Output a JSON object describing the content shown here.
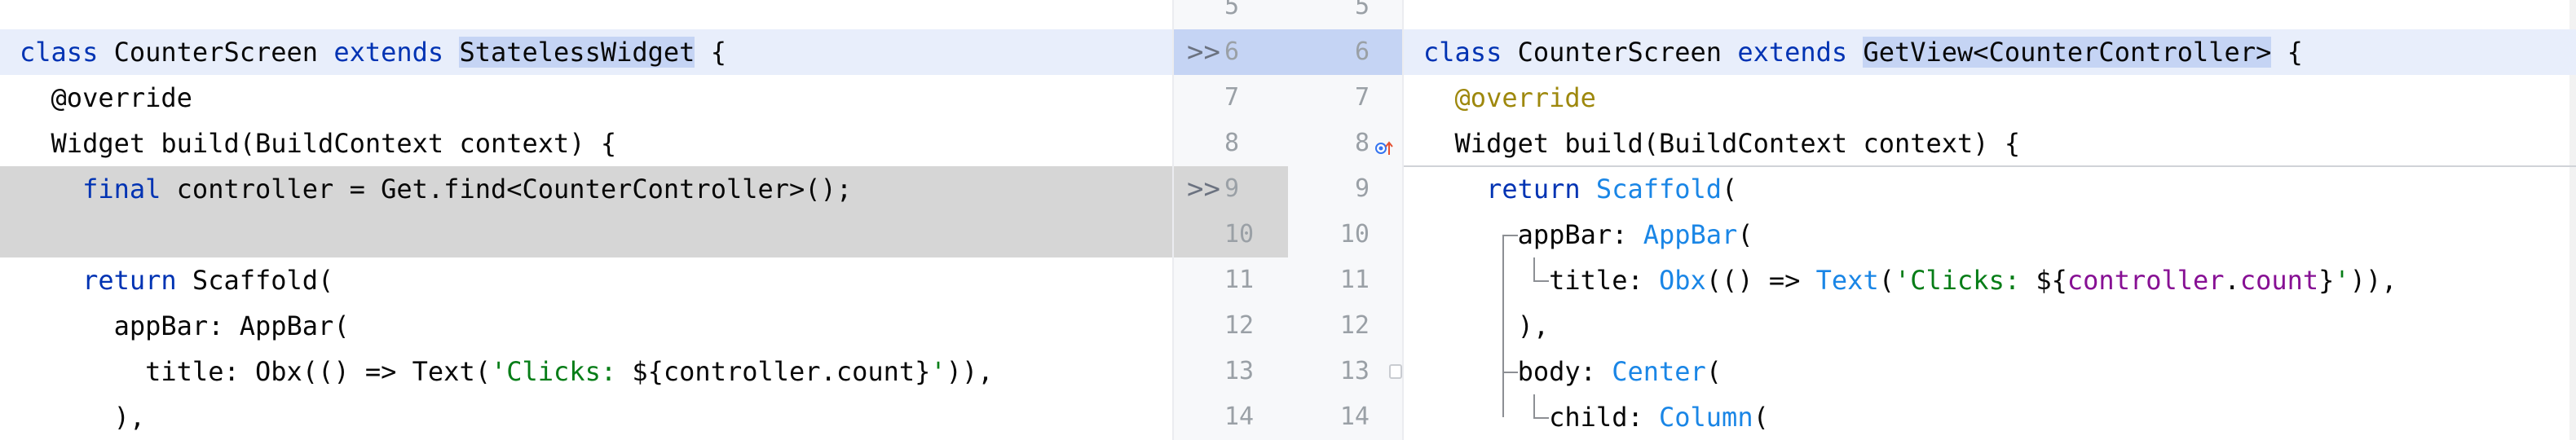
{
  "left": {
    "lines": [
      {
        "tokens": [
          {
            "t": "class ",
            "c": "kw"
          },
          {
            "t": "CounterScreen ",
            "c": "plain"
          },
          {
            "t": "extends ",
            "c": "kw"
          },
          {
            "t": "StatelessWidget",
            "c": "plain",
            "hl": true
          },
          {
            "t": " {",
            "c": "plain"
          }
        ]
      },
      {
        "tokens": [
          {
            "t": "  @override",
            "c": "plain"
          }
        ]
      },
      {
        "tokens": [
          {
            "t": "  Widget build(BuildContext context) {",
            "c": "plain"
          }
        ]
      },
      {
        "tokens": [
          {
            "t": "    ",
            "c": "plain"
          },
          {
            "t": "final ",
            "c": "kw"
          },
          {
            "t": "controller = Get.find<CounterController>();",
            "c": "plain"
          }
        ]
      },
      {
        "tokens": [
          {
            "t": "",
            "c": "plain"
          }
        ]
      },
      {
        "tokens": [
          {
            "t": "    ",
            "c": "plain"
          },
          {
            "t": "return ",
            "c": "kw"
          },
          {
            "t": "Scaffold(",
            "c": "plain"
          }
        ]
      },
      {
        "tokens": [
          {
            "t": "      appBar: AppBar(",
            "c": "plain"
          }
        ]
      },
      {
        "tokens": [
          {
            "t": "        title: Obx(() => Text(",
            "c": "plain"
          },
          {
            "t": "'Clicks: ",
            "c": "str"
          },
          {
            "t": "${controller.count}",
            "c": "plain"
          },
          {
            "t": "'",
            "c": "str"
          },
          {
            "t": ")),",
            "c": "plain"
          }
        ]
      },
      {
        "tokens": [
          {
            "t": "      ),",
            "c": "plain"
          }
        ]
      }
    ]
  },
  "gutter": {
    "left_numbers": [
      "5",
      "6",
      "7",
      "8",
      "9",
      "10",
      "11",
      "12",
      "13",
      "14"
    ],
    "right_numbers": [
      "5",
      "6",
      "7",
      "8",
      "9",
      "10",
      "11",
      "12",
      "13",
      "14"
    ],
    "markers": [
      ">>",
      ">>"
    ]
  },
  "right": {
    "lines": [
      {
        "tokens": [
          {
            "t": "class ",
            "c": "kw"
          },
          {
            "t": "CounterScreen ",
            "c": "plain"
          },
          {
            "t": "extends ",
            "c": "kw"
          },
          {
            "t": "GetView<CounterController>",
            "c": "plain",
            "hl": true
          },
          {
            "t": " {",
            "c": "plain"
          }
        ]
      },
      {
        "tokens": [
          {
            "t": "  ",
            "c": "plain"
          },
          {
            "t": "@override",
            "c": "ann"
          }
        ]
      },
      {
        "tokens": [
          {
            "t": "  Widget ",
            "c": "plain"
          },
          {
            "t": "build",
            "c": "plain"
          },
          {
            "t": "(BuildContext context) {",
            "c": "plain"
          }
        ]
      },
      {
        "tokens": [
          {
            "t": "    ",
            "c": "plain"
          },
          {
            "t": "return ",
            "c": "kw"
          },
          {
            "t": "Scaffold",
            "c": "fn"
          },
          {
            "t": "(",
            "c": "plain"
          }
        ]
      },
      {
        "tokens": [
          {
            "t": "      appBar: ",
            "c": "plain"
          },
          {
            "t": "AppBar",
            "c": "fn"
          },
          {
            "t": "(",
            "c": "plain"
          }
        ]
      },
      {
        "tokens": [
          {
            "t": "        title: ",
            "c": "plain"
          },
          {
            "t": "Obx",
            "c": "fn"
          },
          {
            "t": "(() => ",
            "c": "plain"
          },
          {
            "t": "Text",
            "c": "fn"
          },
          {
            "t": "(",
            "c": "plain"
          },
          {
            "t": "'Clicks: ",
            "c": "str"
          },
          {
            "t": "${",
            "c": "plain"
          },
          {
            "t": "controller",
            "c": "field"
          },
          {
            "t": ".",
            "c": "plain"
          },
          {
            "t": "count",
            "c": "field"
          },
          {
            "t": "}",
            "c": "plain"
          },
          {
            "t": "'",
            "c": "str"
          },
          {
            "t": ")),",
            "c": "plain"
          }
        ]
      },
      {
        "tokens": [
          {
            "t": "      ),",
            "c": "plain"
          }
        ]
      },
      {
        "tokens": [
          {
            "t": "      body: ",
            "c": "plain"
          },
          {
            "t": "Center",
            "c": "fn"
          },
          {
            "t": "(",
            "c": "plain"
          }
        ]
      },
      {
        "tokens": [
          {
            "t": "        child: ",
            "c": "plain"
          },
          {
            "t": "Column",
            "c": "fn"
          },
          {
            "t": "(",
            "c": "plain"
          }
        ]
      }
    ]
  }
}
